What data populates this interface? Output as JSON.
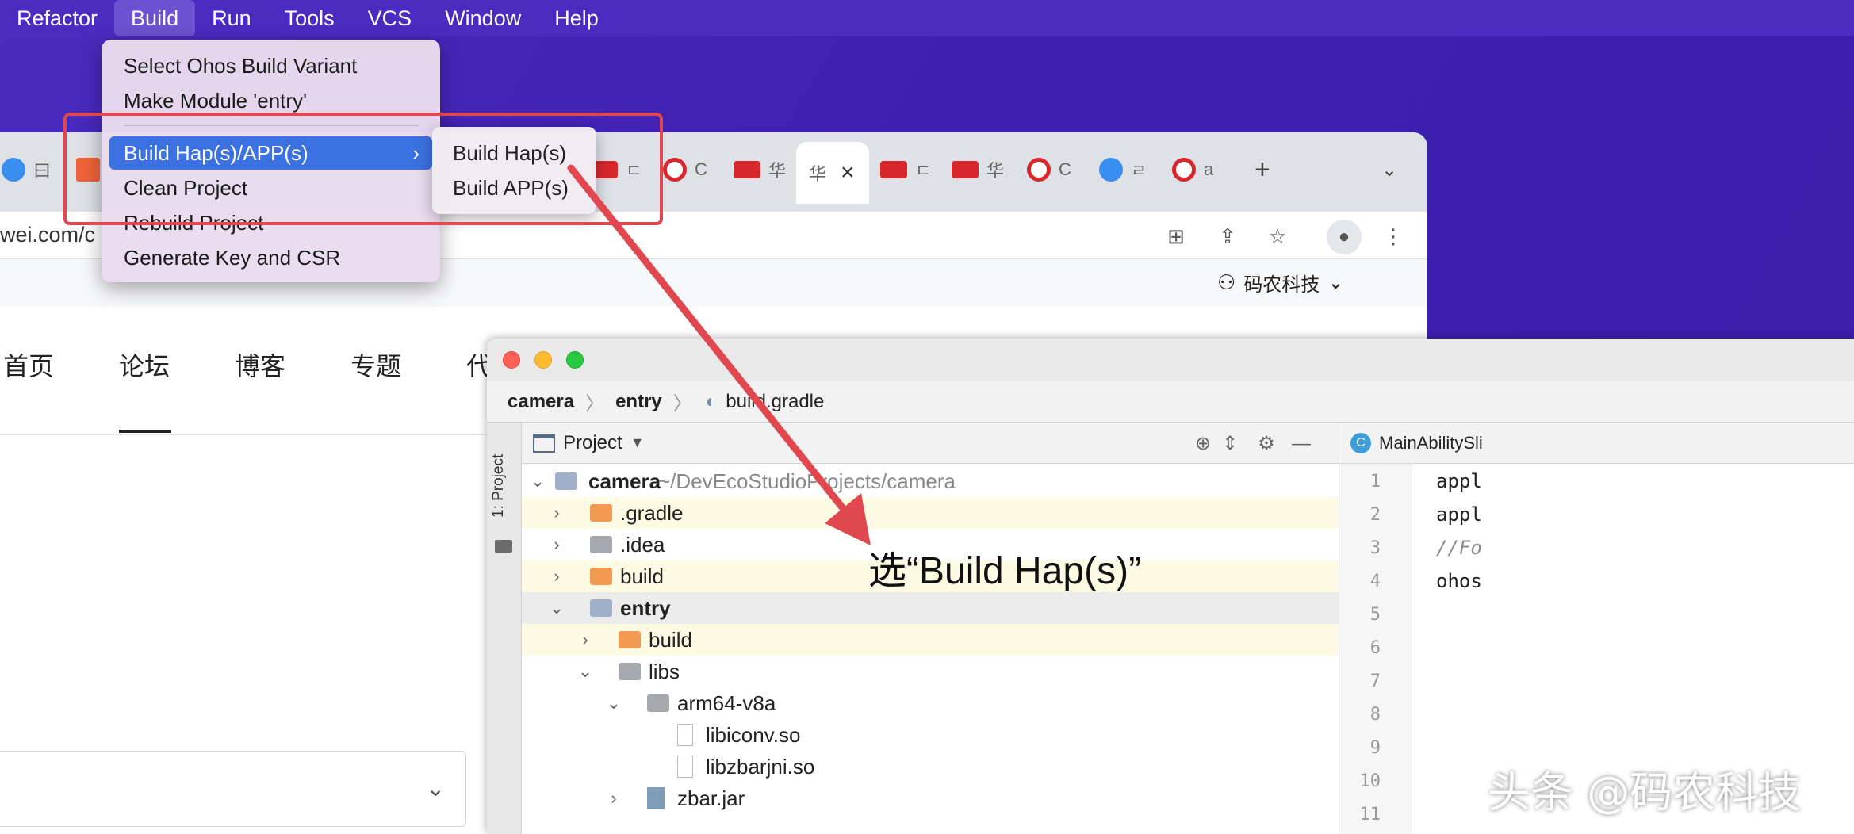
{
  "menubar": {
    "items": [
      "Refactor",
      "Build",
      "Run",
      "Tools",
      "VCS",
      "Window",
      "Help"
    ],
    "active": "Build"
  },
  "build_menu": {
    "items": [
      "Select Ohos Build Variant",
      "Make Module 'entry'",
      "Build Hap(s)/APP(s)",
      "Clean Project",
      "Rebuild Project",
      "Generate Key and CSR"
    ],
    "highlighted": "Build Hap(s)/APP(s)"
  },
  "submenu": {
    "items": [
      "Build Hap(s)",
      "Build APP(s)"
    ]
  },
  "browser": {
    "url_fragment": "wei.com/c",
    "tab_snippets": [
      "曰",
      "C",
      "ㄷ",
      "华",
      "G",
      "ㄷ",
      "G",
      "C",
      "华",
      "G",
      "ㄹ",
      "a"
    ],
    "active_tab_text": "华",
    "user_name": "码农科技",
    "nav_items": [
      "首页",
      "论坛",
      "博客",
      "专题",
      "代"
    ],
    "nav_active": "论坛"
  },
  "ide": {
    "breadcrumb": [
      "camera",
      "entry",
      "build.gradle"
    ],
    "side_label": "1: Project",
    "panel_title": "Project",
    "tree": [
      {
        "name": "camera",
        "path": "~/DevEcoStudioProjects/camera",
        "bold": true
      },
      {
        "name": ".gradle"
      },
      {
        "name": ".idea"
      },
      {
        "name": "build"
      },
      {
        "name": "entry",
        "bold": true
      },
      {
        "name": "build"
      },
      {
        "name": "libs"
      },
      {
        "name": "arm64-v8a"
      },
      {
        "name": "libiconv.so"
      },
      {
        "name": "libzbarjni.so"
      },
      {
        "name": "zbar.jar"
      }
    ],
    "editor_tab": "MainAbilitySli",
    "editor_tab_icon": "C",
    "line_numbers": [
      "1",
      "2",
      "3",
      "4",
      "5",
      "6",
      "7",
      "8",
      "9",
      "10",
      "11"
    ],
    "code_lines": [
      "appl",
      "appl",
      "//Fo",
      "ohos"
    ]
  },
  "annotation": "选“Build Hap(s)”",
  "watermark": "头条 @码农科技",
  "colors": {
    "menu_highlight": "#3b71e0",
    "callout_red": "#e0474e",
    "desktop": "#4a2bc0"
  }
}
